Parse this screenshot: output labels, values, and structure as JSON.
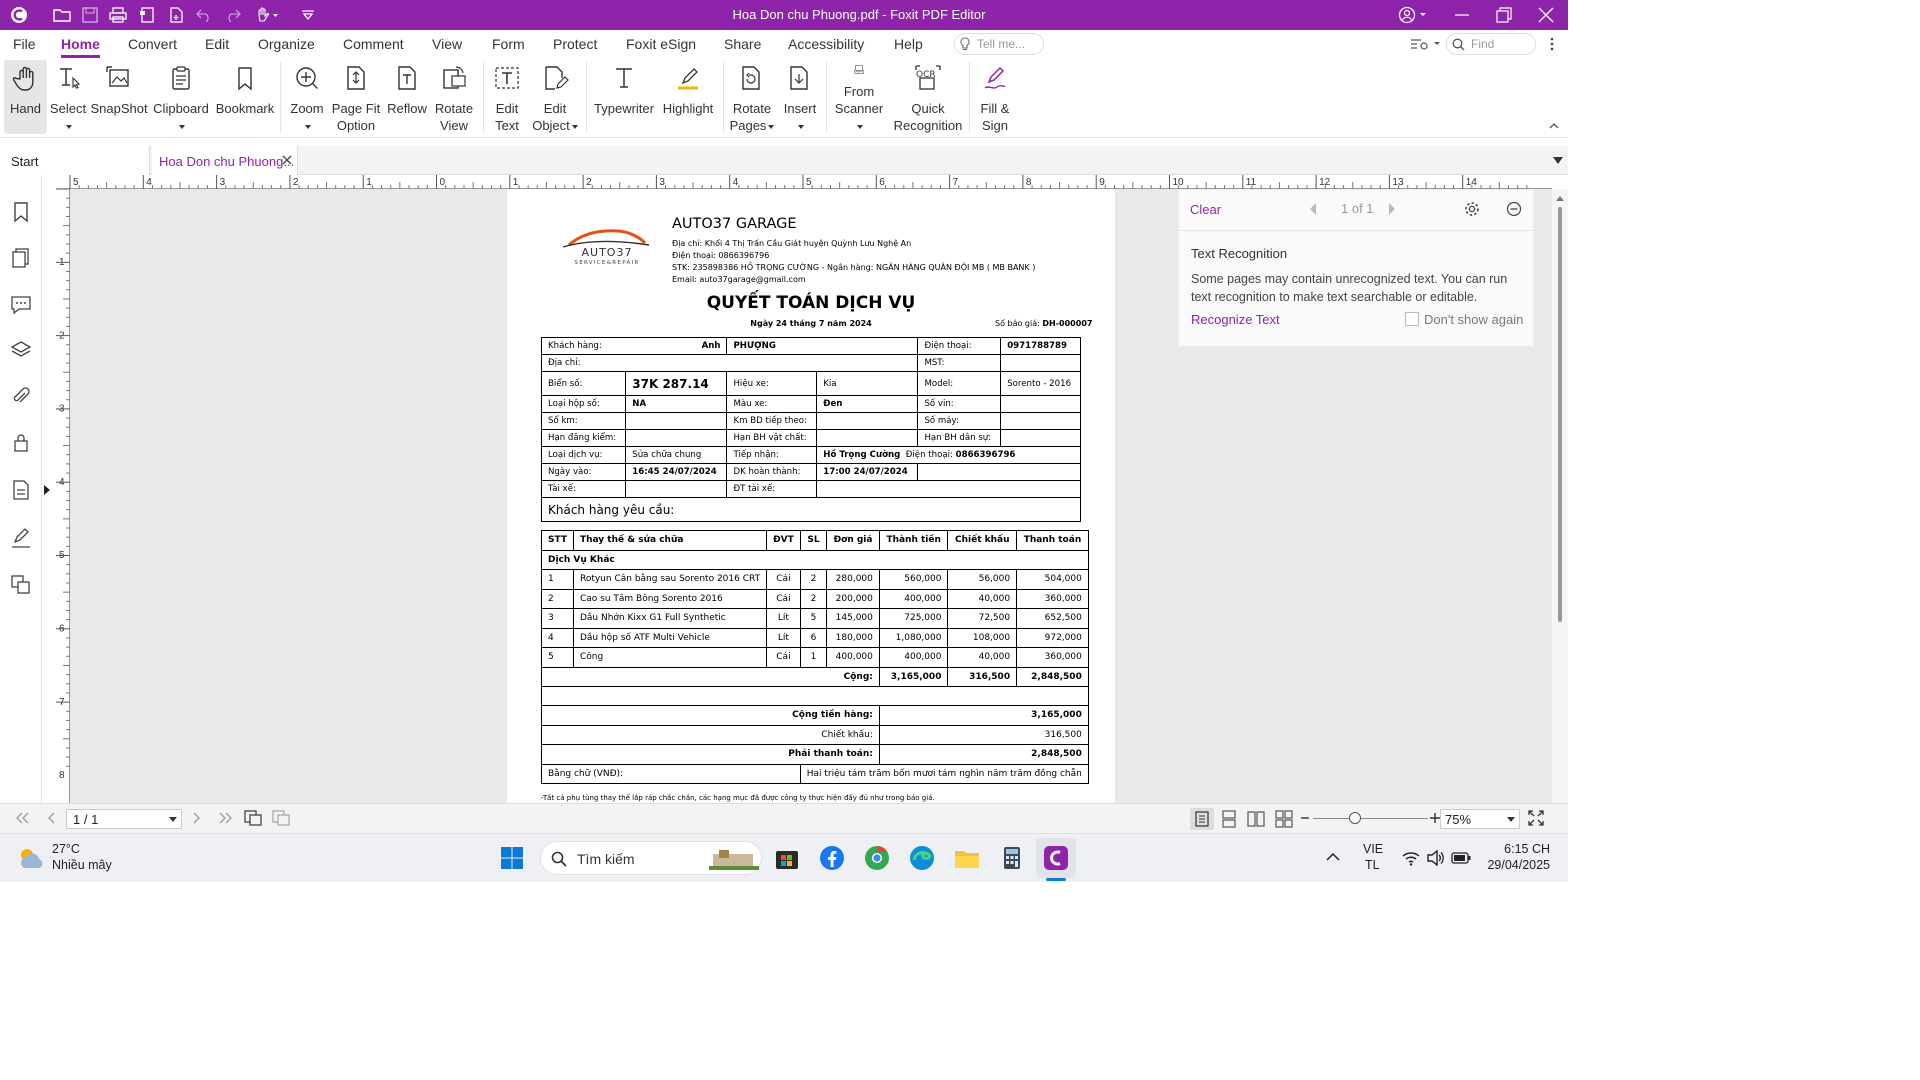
{
  "titlebar": {
    "title": "Hoa Don chu Phuong.pdf - Foxit PDF Editor",
    "accent": "#8e24aa"
  },
  "menu": {
    "items": [
      "File",
      "Home",
      "Convert",
      "Edit",
      "Organize",
      "Comment",
      "View",
      "Form",
      "Protect",
      "Foxit eSign",
      "Share",
      "Accessibility",
      "Help"
    ],
    "tell_me": "Tell me...",
    "find": "Find"
  },
  "ribbon": {
    "hand": "Hand",
    "select": "Select",
    "snapshot": "SnapShot",
    "clipboard": "Clipboard",
    "bookmark": "Bookmark",
    "zoom": "Zoom",
    "page_fit": "Page Fit\nOption",
    "reflow": "Reflow",
    "rotate_view": "Rotate\nView",
    "edit_text": "Edit\nText",
    "edit_object": "Edit\nObject",
    "typewriter": "Typewriter",
    "highlight": "Highlight",
    "rotate_pages": "Rotate\nPages",
    "insert": "Insert",
    "from_scanner": "From\nScanner",
    "quick_recognition": "Quick\nRecognition",
    "fill_sign": "Fill &\nSign"
  },
  "tabs": {
    "start": "Start",
    "doc": "Hoa Don chu Phuong..."
  },
  "ruler": {
    "top": [
      "5",
      "4",
      "3",
      "2",
      "1",
      "0",
      "1",
      "2",
      "3",
      "4",
      "5",
      "6",
      "7",
      "8",
      "9",
      "10",
      "11",
      "12",
      "13",
      "14"
    ],
    "left": [
      "1",
      "2",
      "3",
      "4",
      "5",
      "6",
      "7",
      "8"
    ]
  },
  "ocr_panel": {
    "clear": "Clear",
    "counter": "1 of 1",
    "heading": "Text Recognition",
    "body": "Some pages may contain unrecognized text. You can run text recognition to make text searchable or editable.",
    "recognize": "Recognize Text",
    "dont_show": "Don't show again"
  },
  "doc": {
    "logo_main": "AUTO37",
    "logo_sub": "SERVICE&REPAIR",
    "company": "AUTO37 GARAGE",
    "address": "Địa chỉ: Khối 4 Thị Trấn Cầu Giát huyện Quỳnh Lưu Nghệ An",
    "phone": "Điện thoại: 0866396796",
    "bank": "STK: 235898386 HỒ TRỌNG CƯỜNG - Ngân hàng: NGÂN HÀNG QUÂN ĐỘI MB ( MB BANK )",
    "email": "Email: auto37garage@gmail.com",
    "title": "QUYẾT TOÁN DỊCH VỤ",
    "date": "Ngày 24 tháng 7 năm 2024",
    "quote_label": "Số báo giá:",
    "quote_no": "DH-000007",
    "info": {
      "kh_label": "Khách hàng:",
      "kh_title": "Anh",
      "kh_name": "PHƯỢNG",
      "dt_label": "Điện thoại:",
      "dt": "0971788789",
      "dc_label": "Địa chỉ:",
      "mst_label": "MST:",
      "bs_label": "Biển số:",
      "bs": "37K 287.14",
      "hx_label": "Hiệu xe:",
      "hx": "Kia",
      "model_label": "Model:",
      "model": "Sorento - 2016",
      "lhs_label": "Loại hộp số:",
      "lhs": "NA",
      "mx_label": "Màu xe:",
      "mx": "Đen",
      "vin_label": "Số vin:",
      "km_label": "Số km:",
      "kmbd_label": "Km BD tiếp theo:",
      "sm_label": "Số máy:",
      "hdk_label": "Hạn đăng kiểm:",
      "hbhvc_label": "Hạn BH vật chất:",
      "hbhds_label": "Hạn BH dân sự:",
      "ldv_label": "Loại dịch vụ:",
      "ldv": "Sửa chữa chung",
      "tn_label": "Tiếp nhận:",
      "tn": "Hồ Trọng Cường",
      "tn_dt_label": "Điện thoại:",
      "tn_dt": "0866396796",
      "nv_label": "Ngày vào:",
      "nv": "16:45 24/07/2024",
      "dkht_label": "DK hoàn thành:",
      "dkht": "17:00 24/07/2024",
      "tx_label": "Tài xế:",
      "dttx_label": "ĐT tài xế:",
      "yc_label": "Khách hàng yêu cầu:"
    },
    "items_header": [
      "STT",
      "Thay thế & sửa chữa",
      "ĐVT",
      "SL",
      "Đơn giá",
      "Thành tiền",
      "Chiết khấu",
      "Thanh toán"
    ],
    "group": "Dịch Vụ Khác",
    "items": [
      [
        "1",
        "Rotyun Cân bằng sau Sorento 2016 CRT",
        "Cái",
        "2",
        "280,000",
        "560,000",
        "56,000",
        "504,000"
      ],
      [
        "2",
        "Cao su Tăm Bông Sorento 2016",
        "Cái",
        "2",
        "200,000",
        "400,000",
        "40,000",
        "360,000"
      ],
      [
        "3",
        "Dầu Nhớn Kixx G1 Full Synthetic",
        "Lít",
        "5",
        "145,000",
        "725,000",
        "72,500",
        "652,500"
      ],
      [
        "4",
        "Dầu hộp số ATF Multi Vehicle",
        "Lít",
        "6",
        "180,000",
        "1,080,000",
        "108,000",
        "972,000"
      ],
      [
        "5",
        "Công",
        "Cái",
        "1",
        "400,000",
        "400,000",
        "40,000",
        "360,000"
      ]
    ],
    "subtotal_label": "Cộng:",
    "subtotal": [
      "3,165,000",
      "316,500",
      "2,848,500"
    ],
    "sum_goods_label": "Cộng tiền hàng:",
    "sum_goods": "3,165,000",
    "discount_label": "Chiết khấu:",
    "discount": "316,500",
    "pay_label": "Phải thanh toán:",
    "pay": "2,848,500",
    "words_label": "Bằng chữ (VNĐ):",
    "words": "Hai triệu tám trăm bốn mươi tám nghìn năm trăm đồng chẵn",
    "footnote": "-Tất cả phụ tùng thay thế lắp ráp chắc chắn, các hạng mục đã được công ty thực hiện đầy đủ như trong báo giá."
  },
  "status": {
    "page": "1 / 1",
    "zoom": "75%"
  },
  "taskbar": {
    "temp": "27°C",
    "weather": "Nhiều mây",
    "search": "Tìm kiếm",
    "lang1": "VIE",
    "lang2": "TL",
    "time": "6:15 CH",
    "date": "29/04/2025"
  }
}
